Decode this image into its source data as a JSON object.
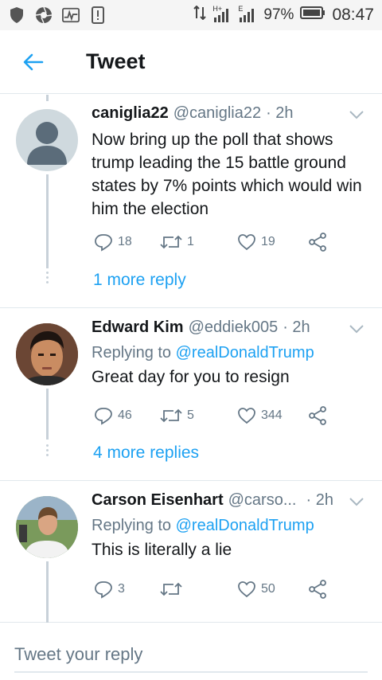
{
  "status_bar": {
    "network": "H+",
    "network2": "E",
    "battery": "97%",
    "time": "08:47"
  },
  "header": {
    "title": "Tweet",
    "back_icon": "arrow-left-icon"
  },
  "colors": {
    "accent": "#1da1f2",
    "text": "#14171a",
    "muted": "#657786",
    "divider": "#e1e8ed"
  },
  "tweets": [
    {
      "name": "caniglia22",
      "handle": "@caniglia22",
      "time": "· 2h",
      "reply_to_label": "",
      "reply_to_handle": "",
      "text": "Now bring up the poll that shows trump leading the 15 battle ground states by 7% points which would win him the election",
      "replies": "18",
      "retweets": "1",
      "likes": "19",
      "more_replies": "1 more reply"
    },
    {
      "name": "Edward Kim",
      "handle": "@eddiek005",
      "time": "· 2h",
      "reply_to_label": "Replying to",
      "reply_to_handle": "@realDonaldTrump",
      "text": "Great day for you to resign",
      "replies": "46",
      "retweets": "5",
      "likes": "344",
      "more_replies": "4 more replies"
    },
    {
      "name": "Carson Eisenhart",
      "handle": "@carso...",
      "time": "· 2h",
      "reply_to_label": "Replying to",
      "reply_to_handle": "@realDonaldTrump",
      "text": "This is literally a lie",
      "replies": "3",
      "retweets": "",
      "likes": "50",
      "more_replies": ""
    }
  ],
  "composer": {
    "placeholder": "Tweet your reply"
  }
}
